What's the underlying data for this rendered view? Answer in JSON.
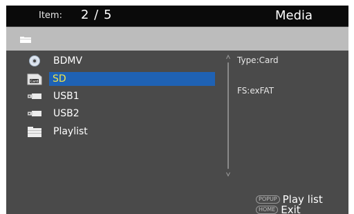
{
  "header": {
    "item_label": "Item:",
    "item_value": "2 / 5",
    "title": "Media"
  },
  "pathbar": {
    "icon": "folder-icon"
  },
  "list": {
    "items": [
      {
        "label": "BDMV",
        "icon": "disc-icon"
      },
      {
        "label": "SD",
        "icon": "sd-card-icon",
        "selected": true
      },
      {
        "label": "USB1",
        "icon": "usb-icon"
      },
      {
        "label": "USB2",
        "icon": "usb-icon"
      },
      {
        "label": "Playlist",
        "icon": "folder-icon"
      }
    ],
    "card_badge": "Card"
  },
  "info": {
    "type": "Type:Card",
    "fs": "FS:exFAT"
  },
  "hints": {
    "popup_key": "POPUP",
    "popup_text": "Play list",
    "home_key": "HOME",
    "home_text": "Exit"
  },
  "colors": {
    "selection": "#1f62b4",
    "selected_text": "#f2e64a",
    "background": "#4a4a4a"
  }
}
